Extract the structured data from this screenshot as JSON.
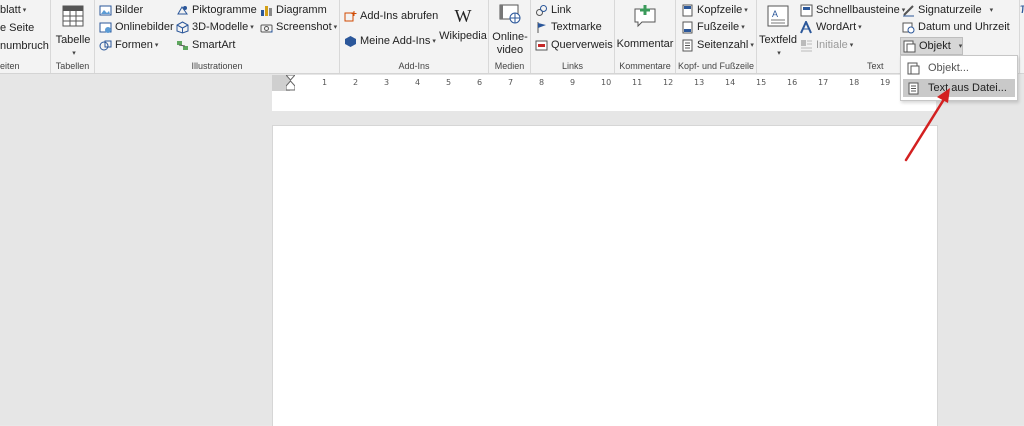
{
  "ribbon": {
    "pages": {
      "items": [
        "blatt",
        "e Seite",
        "numbruch"
      ],
      "label": "eiten"
    },
    "tables": {
      "button": "Tabelle",
      "label": "Tabellen"
    },
    "illustrations": {
      "col1": [
        "Bilder",
        "Onlinebilder",
        "Formen"
      ],
      "col2": [
        "Piktogramme",
        "3D-Modelle",
        "SmartArt"
      ],
      "col3": [
        "Diagramm",
        "Screenshot"
      ],
      "label": "Illustrationen"
    },
    "addins": {
      "get": "Add-Ins abrufen",
      "mine": "Meine Add-Ins",
      "wiki_glyph": "W",
      "wikipedia": "Wikipedia",
      "label": "Add-Ins"
    },
    "media": {
      "line1": "Online-",
      "line2": "video",
      "label": "Medien"
    },
    "links": {
      "items": [
        "Link",
        "Textmarke",
        "Querverweis"
      ],
      "label": "Links"
    },
    "comments": {
      "button": "Kommentar",
      "label": "Kommentare"
    },
    "header_footer": {
      "items": [
        "Kopfzeile",
        "Fußzeile",
        "Seitenzahl"
      ],
      "label": "Kopf- und Fußzeile"
    },
    "text": {
      "textbox": "Textfeld",
      "col1": [
        "Schnellbausteine",
        "WordArt",
        "Initiale"
      ],
      "col2": [
        "Signaturzeile",
        "Datum und Uhrzeit",
        "Objekt"
      ],
      "label": "Text"
    },
    "symbols_glyph": "π"
  },
  "ruler": {
    "ticks": [
      "1",
      "2",
      "3",
      "4",
      "5",
      "6",
      "7",
      "8",
      "9",
      "10",
      "11",
      "12",
      "13",
      "14",
      "15",
      "16",
      "17",
      "18",
      "19"
    ]
  },
  "menu": {
    "items": [
      "Objekt...",
      "Text aus Datei..."
    ]
  },
  "colors": {
    "accent": "#2b579a",
    "annotation_arrow": "#d32020",
    "highlight": "#c9c9c9"
  }
}
